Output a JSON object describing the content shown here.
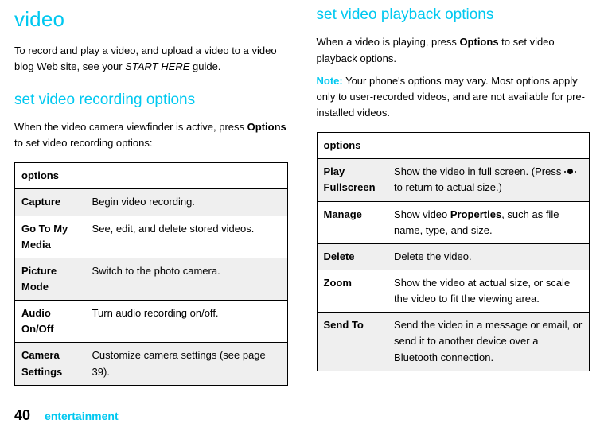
{
  "left": {
    "title": "video",
    "intro_before_italic": "To record and play a video, and upload a video to a video blog Web site, see your ",
    "intro_italic": "START HERE",
    "intro_after_italic": " guide.",
    "sub_title": "set video recording options",
    "body_before_opts": "When the video camera viewfinder is active, press ",
    "opts_word": "Options",
    "body_after_opts": " to set video recording options:",
    "table_header": "options",
    "rows": [
      {
        "name": "Capture",
        "desc": "Begin video recording."
      },
      {
        "name": "Go To My Media",
        "desc": "See, edit, and delete stored videos."
      },
      {
        "name": "Picture Mode",
        "desc": "Switch to the photo camera."
      },
      {
        "name": "Audio On/Off",
        "desc": "Turn audio recording on/off."
      },
      {
        "name": "Camera Settings",
        "desc": "Customize camera settings (see page 39)."
      }
    ]
  },
  "right": {
    "sub_title": "set video playback options",
    "body_before_opts": "When a video is playing, press ",
    "opts_word": "Options",
    "body_after_opts": " to set video playback options.",
    "note_label": "Note:",
    "note_text": " Your phone's options may vary. Most options apply only to user-recorded videos, and are not available for pre-installed videos.",
    "table_header": "options",
    "rows": [
      {
        "name": "Play Fullscreen",
        "desc_before": "Show the video in full screen. (Press ",
        "desc_after": " to return to actual size.)"
      },
      {
        "name": "Manage",
        "desc_before": "Show video ",
        "desc_bold": "Properties",
        "desc_after": ", such as file name, type, and size."
      },
      {
        "name": "Delete",
        "desc": "Delete the video."
      },
      {
        "name": "Zoom",
        "desc": "Show the video at actual size, or scale the video to fit the viewing area."
      },
      {
        "name": "Send To",
        "desc": "Send the video in a message or email, or send it to another device over a Bluetooth connection."
      }
    ]
  },
  "footer": {
    "page": "40",
    "label": "entertainment"
  }
}
